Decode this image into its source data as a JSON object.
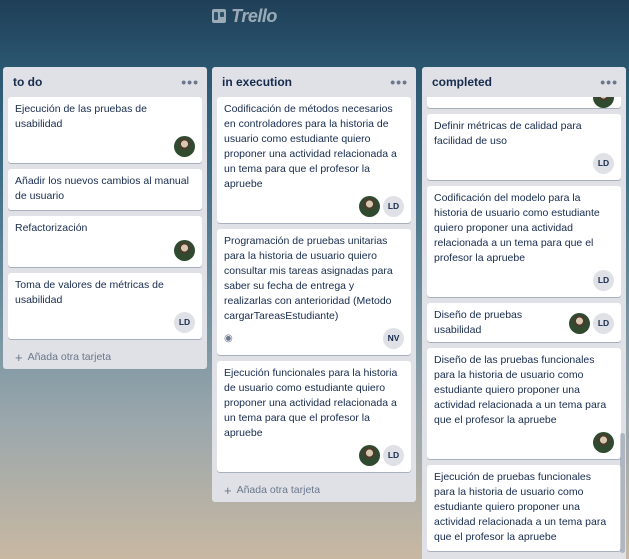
{
  "app": {
    "logo_text": "Trello"
  },
  "lists": [
    {
      "title": "to do",
      "cards": [
        {
          "title": "Ejecución de las pruebas de usabilidad",
          "members": [
            {
              "type": "photo"
            }
          ]
        },
        {
          "title": "Añadir los nuevos cambios al manual de usuario",
          "members": []
        },
        {
          "title": "Refactorización",
          "members": [
            {
              "type": "photo"
            }
          ]
        },
        {
          "title": "Toma de valores de métricas de usabilidad",
          "members": [
            {
              "type": "initials",
              "text": "LD"
            }
          ]
        }
      ],
      "add_label": "Añada otra tarjeta"
    },
    {
      "title": "in execution",
      "cards": [
        {
          "title": "Codificación de métodos necesarios en controladores para la historia de usuario como estudiante quiero proponer una actividad relacionada a un tema para que el profesor la apruebe",
          "members": [
            {
              "type": "photo"
            },
            {
              "type": "initials",
              "text": "LD"
            }
          ]
        },
        {
          "title": "Programación de pruebas unitarias para la historia de usuario quiero consultar mis tareas asignadas para saber su fecha de entrega y realizarlas con anterioridad (Metodo cargarTareasEstudiante)",
          "watch": true,
          "members": [
            {
              "type": "initials",
              "text": "NV"
            }
          ]
        },
        {
          "title": "Ejecución funcionales para la historia de usuario como estudiante quiero proponer una actividad relacionada a un tema para que el profesor la apruebe",
          "members": [
            {
              "type": "photo"
            },
            {
              "type": "initials",
              "text": "LD"
            }
          ]
        }
      ],
      "add_label": "Añada otra tarjeta"
    },
    {
      "title": "completed",
      "cards": [
        {
          "title": "Definir métricas de calidad para facilidad de uso",
          "members": [
            {
              "type": "initials",
              "text": "LD"
            }
          ]
        },
        {
          "title": "Codificación del modelo para la historia de usuario como estudiante quiero proponer una actividad relacionada a un tema para que el profesor la apruebe",
          "members": [
            {
              "type": "initials",
              "text": "LD"
            }
          ]
        },
        {
          "title": "Diseño de pruebas usabilidad",
          "members": [
            {
              "type": "photo"
            },
            {
              "type": "initials",
              "text": "LD"
            }
          ]
        },
        {
          "title": "Diseño de las pruebas funcionales para la historia de usuario como estudiante quiero proponer una actividad relacionada a un tema para que el profesor la apruebe",
          "members": [
            {
              "type": "photo"
            }
          ]
        },
        {
          "title": "Ejecución de pruebas funcionales para la historia de usuario como estudiante quiero proponer una actividad relacionada a un tema para que el profesor la apruebe",
          "members": []
        }
      ]
    }
  ],
  "icons": {
    "menu": "ellipsis-icon",
    "add": "plus-icon",
    "watch": "eye-icon",
    "logo": "trello-board-icon"
  }
}
